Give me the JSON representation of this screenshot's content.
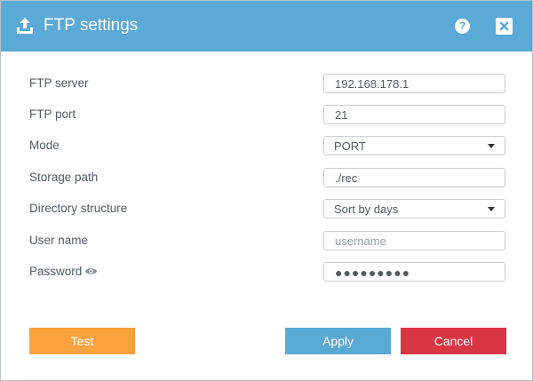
{
  "dialog": {
    "title": "FTP settings",
    "help_label": "?",
    "colors": {
      "titlebar": "#5aa9d6",
      "test_button": "#fba13e",
      "apply_button": "#59a9d5",
      "cancel_button": "#d93645"
    }
  },
  "form": {
    "ftp_server": {
      "label": "FTP server",
      "value": "192.168.178.1"
    },
    "ftp_port": {
      "label": "FTP port",
      "value": "21"
    },
    "mode": {
      "label": "Mode",
      "selected": "PORT"
    },
    "storage_path": {
      "label": "Storage path",
      "value": "./rec"
    },
    "directory_structure": {
      "label": "Directory structure",
      "selected": "Sort by days"
    },
    "user_name": {
      "label": "User name",
      "placeholder": "username"
    },
    "password": {
      "label": "Password",
      "masked_value": "●●●●●●●●●"
    }
  },
  "buttons": {
    "test": "Test",
    "apply": "Apply",
    "cancel": "Cancel"
  },
  "icons": {
    "title": "upload-icon",
    "help": "help-icon",
    "close": "close-icon",
    "password_toggle": "eye-icon",
    "dropdown": "caret-down-icon"
  }
}
